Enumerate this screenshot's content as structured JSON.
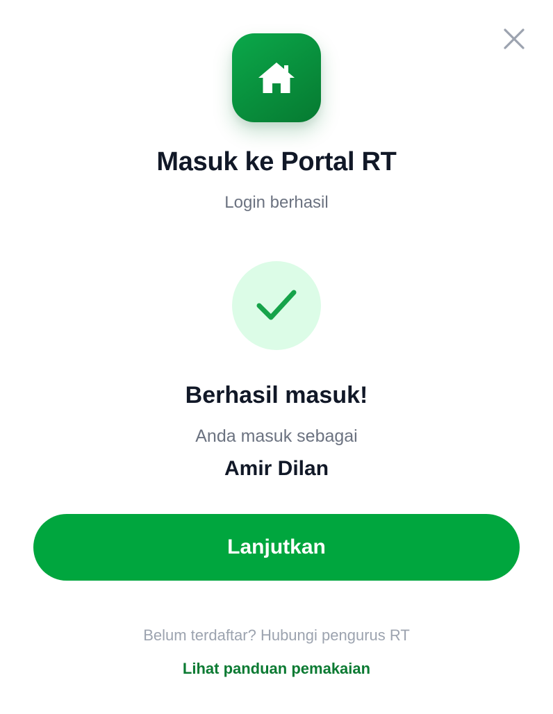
{
  "dialog": {
    "title": "Masuk ke Portal RT",
    "subtitle": "Login berhasil",
    "close_icon": "close-icon",
    "app_icon": "home-icon"
  },
  "status": {
    "icon": "check-icon",
    "heading": "Berhasil masuk!",
    "signed_in_as_label": "Anda masuk sebagai",
    "user_name": "Amir Dilan"
  },
  "actions": {
    "continue_label": "Lanjutkan"
  },
  "footer": {
    "note": "Belum terdaftar? Hubungi pengurus RT",
    "guide_link": "Lihat panduan pemakaian"
  },
  "colors": {
    "primary_green": "#00a63e",
    "dark_green": "#067a31",
    "success_bg": "#dcfce7",
    "success_check": "#16a34a",
    "muted_text": "#6b7280",
    "light_text": "#9ca3af",
    "close_icon": "#9ca3af"
  }
}
